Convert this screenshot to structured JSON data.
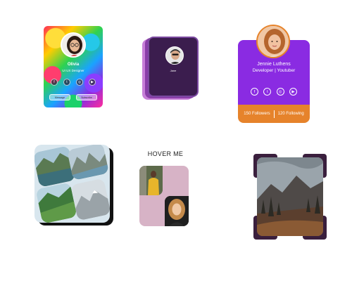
{
  "cards": {
    "rainbow": {
      "name": "Olivia",
      "role": "UI UX Designer",
      "social_icons": [
        "facebook-icon",
        "twitter-icon",
        "instagram-icon",
        "youtube-icon"
      ],
      "buttons": [
        "Message",
        "Subscribe"
      ]
    },
    "stacked": {
      "name": "Jane"
    },
    "jennie": {
      "name": "Jennie Luthens",
      "role": "Developer | Youtuber",
      "social_icons": [
        "facebook-icon",
        "twitter-icon",
        "instagram-icon",
        "youtube-icon"
      ],
      "followers": "150 Followers",
      "following": "120 Following"
    },
    "hover": {
      "title": "HOVER ME"
    }
  },
  "colors": {
    "purple": "#8a2be2",
    "orange": "#e6832b",
    "dark_purple": "#3b1d4e",
    "pink": "#d7b3c6",
    "frame": "#3a1f3d"
  }
}
